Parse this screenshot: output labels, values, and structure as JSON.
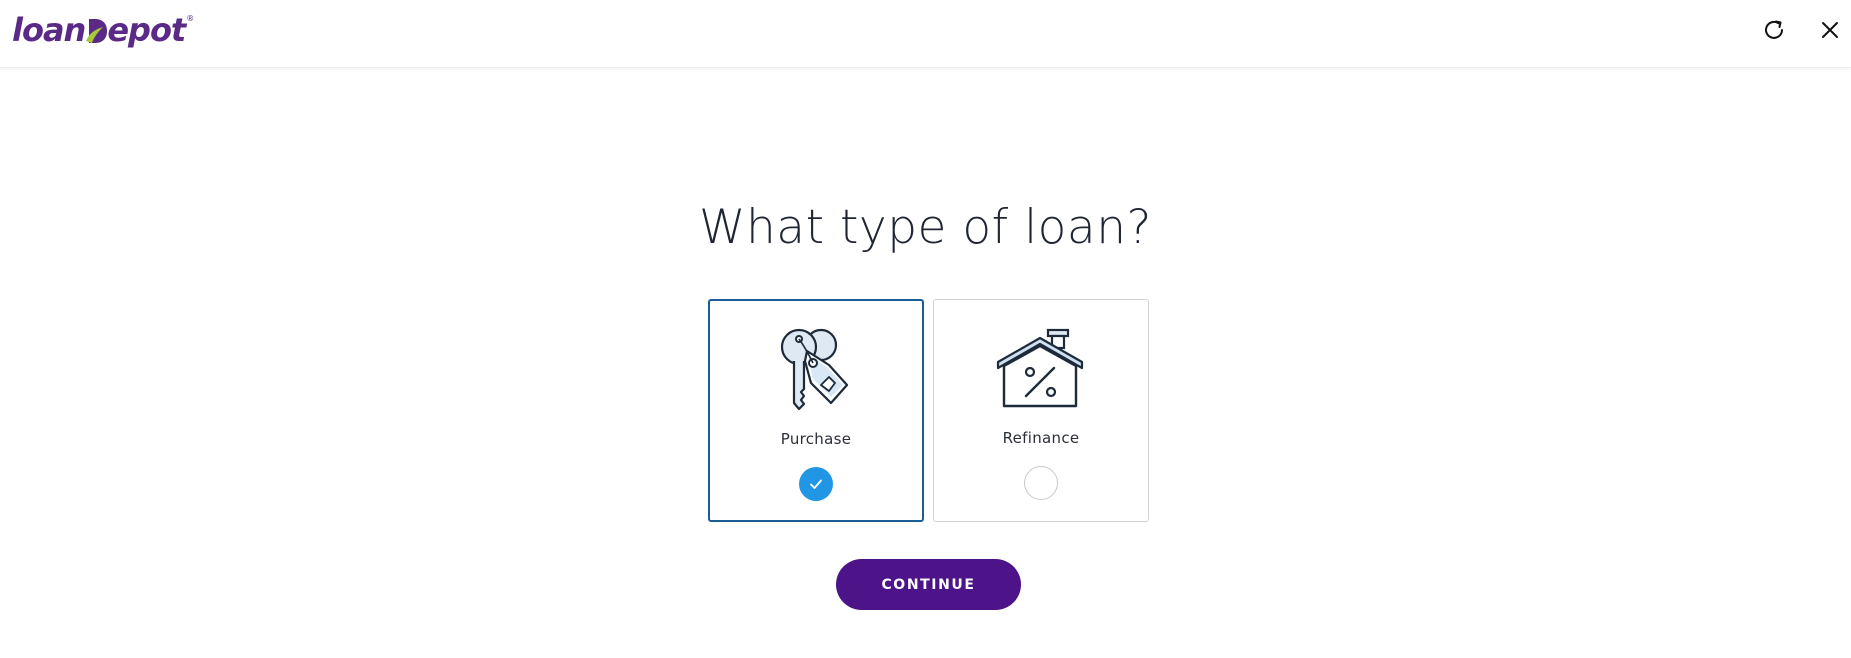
{
  "header": {
    "logo_text_left": "loan",
    "logo_text_right": "epot",
    "logo_registered": "®",
    "refresh_icon": "refresh-icon",
    "close_icon": "close-icon"
  },
  "main": {
    "title": "What type of loan?",
    "options": [
      {
        "label": "Purchase",
        "icon": "keys-tag-icon",
        "selected": true
      },
      {
        "label": "Refinance",
        "icon": "house-percent-icon",
        "selected": false
      }
    ],
    "continue_label": "CONTINUE"
  },
  "colors": {
    "brand_purple": "#4d1388",
    "selected_border": "#1d5d95",
    "check_blue": "#2196e5",
    "title_text": "#1f2533"
  }
}
